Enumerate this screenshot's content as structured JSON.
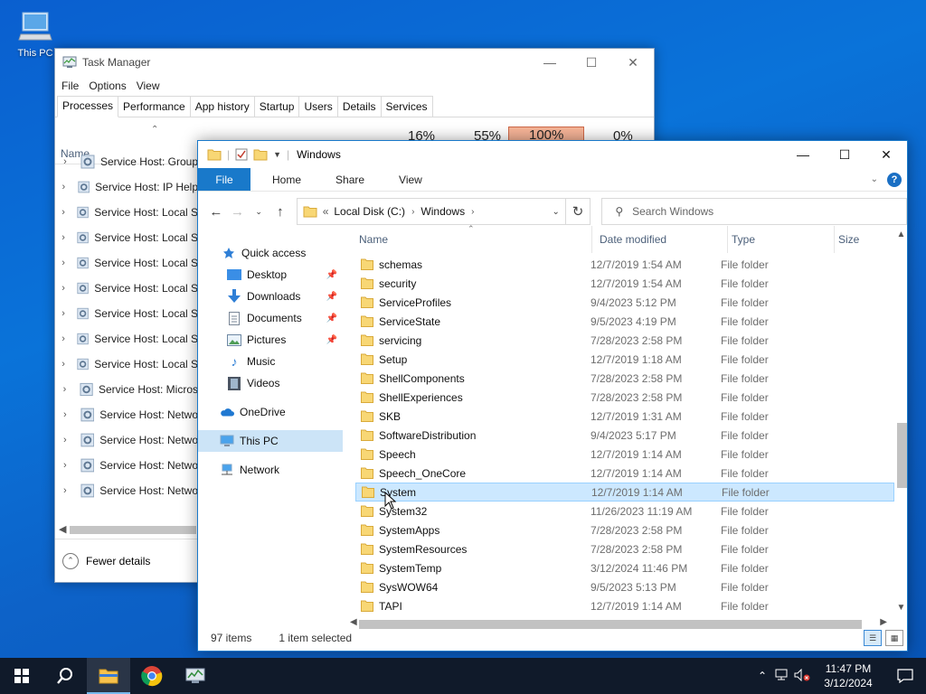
{
  "desktop": {
    "this_pc_label": "This PC"
  },
  "task_manager": {
    "title": "Task Manager",
    "menu": [
      "File",
      "Options",
      "View"
    ],
    "tabs": [
      "Processes",
      "Performance",
      "App history",
      "Startup",
      "Users",
      "Details",
      "Services"
    ],
    "active_tab": "Processes",
    "name_col": "Name",
    "usage": {
      "cpu": "16%",
      "memory": "55%",
      "disk": "100%",
      "network": "0%"
    },
    "rows": [
      "Service Host: Group",
      "Service Host: IP Help",
      "Service Host: Local S",
      "Service Host: Local S",
      "Service Host: Local S",
      "Service Host: Local S",
      "Service Host: Local S",
      "Service Host: Local S",
      "Service Host: Local S",
      "Service Host: Micros",
      "Service Host: Netwo",
      "Service Host: Netwo",
      "Service Host: Netwo",
      "Service Host: Netwo",
      "Service Host: Netwo"
    ],
    "fewer_details": "Fewer details"
  },
  "explorer": {
    "title": "Windows",
    "ribbon": {
      "file": "File",
      "home": "Home",
      "share": "Share",
      "view": "View",
      "help": "?"
    },
    "address": {
      "prefix": "«",
      "crumbs": [
        "Local Disk (C:)",
        "Windows"
      ]
    },
    "search_placeholder": "Search Windows",
    "nav": {
      "quick_access": "Quick access",
      "desktop": "Desktop",
      "downloads": "Downloads",
      "documents": "Documents",
      "pictures": "Pictures",
      "music": "Music",
      "videos": "Videos",
      "onedrive": "OneDrive",
      "this_pc": "This PC",
      "network": "Network"
    },
    "columns": {
      "name": "Name",
      "date": "Date modified",
      "type": "Type",
      "size": "Size"
    },
    "files": [
      {
        "name": "schemas",
        "date": "12/7/2019 1:54 AM",
        "type": "File folder"
      },
      {
        "name": "security",
        "date": "12/7/2019 1:54 AM",
        "type": "File folder"
      },
      {
        "name": "ServiceProfiles",
        "date": "9/4/2023 5:12 PM",
        "type": "File folder"
      },
      {
        "name": "ServiceState",
        "date": "9/5/2023 4:19 PM",
        "type": "File folder"
      },
      {
        "name": "servicing",
        "date": "7/28/2023 2:58 PM",
        "type": "File folder"
      },
      {
        "name": "Setup",
        "date": "12/7/2019 1:18 AM",
        "type": "File folder"
      },
      {
        "name": "ShellComponents",
        "date": "7/28/2023 2:58 PM",
        "type": "File folder"
      },
      {
        "name": "ShellExperiences",
        "date": "7/28/2023 2:58 PM",
        "type": "File folder"
      },
      {
        "name": "SKB",
        "date": "12/7/2019 1:31 AM",
        "type": "File folder"
      },
      {
        "name": "SoftwareDistribution",
        "date": "9/4/2023 5:17 PM",
        "type": "File folder"
      },
      {
        "name": "Speech",
        "date": "12/7/2019 1:14 AM",
        "type": "File folder"
      },
      {
        "name": "Speech_OneCore",
        "date": "12/7/2019 1:14 AM",
        "type": "File folder"
      },
      {
        "name": "System",
        "date": "12/7/2019 1:14 AM",
        "type": "File folder",
        "selected": true
      },
      {
        "name": "System32",
        "date": "11/26/2023 11:19 AM",
        "type": "File folder"
      },
      {
        "name": "SystemApps",
        "date": "7/28/2023 2:58 PM",
        "type": "File folder"
      },
      {
        "name": "SystemResources",
        "date": "7/28/2023 2:58 PM",
        "type": "File folder"
      },
      {
        "name": "SystemTemp",
        "date": "3/12/2024 11:46 PM",
        "type": "File folder"
      },
      {
        "name": "SysWOW64",
        "date": "9/5/2023 5:13 PM",
        "type": "File folder"
      },
      {
        "name": "TAPI",
        "date": "12/7/2019 1:14 AM",
        "type": "File folder"
      }
    ],
    "status": {
      "count": "97 items",
      "selection": "1 item selected"
    }
  },
  "taskbar": {
    "time": "11:47 PM",
    "date": "3/12/2024",
    "accent": "#76b9ed"
  }
}
